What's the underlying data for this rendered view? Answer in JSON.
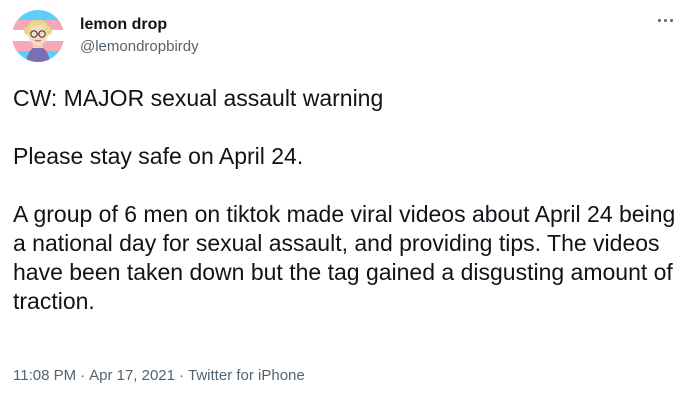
{
  "user": {
    "display_name": "lemon drop",
    "handle": "@lemondropbirdy"
  },
  "tweet": {
    "lines": [
      "CW: MAJOR sexual assault warning",
      "Please stay safe on April 24.",
      "A group of 6 men on tiktok made viral videos about April 24 being a national day for sexual assault, and providing tips. The videos have been taken down but the tag gained a disgusting amount of traction."
    ]
  },
  "meta": {
    "time": "11:08 PM",
    "date": "Apr 17, 2021",
    "source": "Twitter for iPhone",
    "separator": "·"
  },
  "icons": {
    "more": "more-horizontal-icon",
    "avatar": "avatar-image"
  },
  "colors": {
    "text": "#0f1419",
    "secondary": "#536471",
    "flag_blue": "#5bcefa",
    "flag_pink": "#f5a9b8"
  }
}
